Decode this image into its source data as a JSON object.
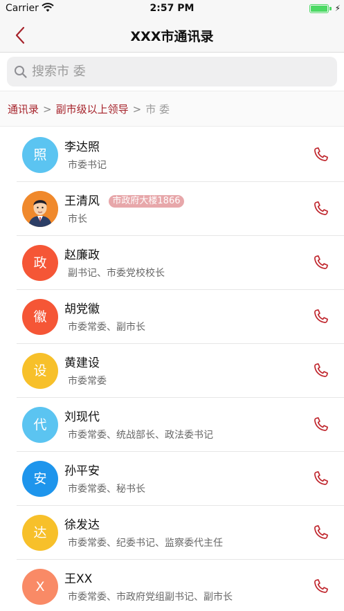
{
  "status_bar": {
    "carrier": "Carrier",
    "time": "2:57 PM"
  },
  "nav": {
    "title": "XXX市通讯录"
  },
  "search": {
    "placeholder": "搜索市 委",
    "value": ""
  },
  "breadcrumb": {
    "items": [
      "通讯录",
      "副市级以上领导"
    ],
    "current": "市 委",
    "separator": ">"
  },
  "contacts": [
    {
      "name": "李达照",
      "title": "市委书记",
      "avatar_char": "照",
      "avatar_color": "#5bc4f1"
    },
    {
      "name": "王清风",
      "title": "市长",
      "tag": "市政府大楼1866",
      "avatar_photo": true,
      "avatar_color": "#f0892c"
    },
    {
      "name": "赵廉政",
      "title": "副书记、市委党校校长",
      "avatar_char": "政",
      "avatar_color": "#f55636"
    },
    {
      "name": "胡党徽",
      "title": "市委常委、副市长",
      "avatar_char": "徽",
      "avatar_color": "#f55636"
    },
    {
      "name": "黄建设",
      "title": "市委常委",
      "avatar_char": "设",
      "avatar_color": "#f7c02a"
    },
    {
      "name": "刘现代",
      "title": "市委常委、统战部长、政法委书记",
      "avatar_char": "代",
      "avatar_color": "#5bc4f1"
    },
    {
      "name": "孙平安",
      "title": "市委常委、秘书长",
      "avatar_char": "安",
      "avatar_color": "#1e95ec"
    },
    {
      "name": "徐发达",
      "title": "市委常委、纪委书记、监察委代主任",
      "avatar_char": "达",
      "avatar_color": "#f7c02a"
    },
    {
      "name": "王XX",
      "title": "市委常委、市政府党组副书记、副市长",
      "avatar_char": "X",
      "avatar_color": "#f98a66"
    }
  ],
  "colors": {
    "accent": "#a6232b",
    "phone_icon": "#c0282f",
    "tag_bg": "#e7a7aa"
  },
  "icons": {
    "back": "chevron-left-icon",
    "search": "search-icon",
    "phone": "phone-icon"
  }
}
